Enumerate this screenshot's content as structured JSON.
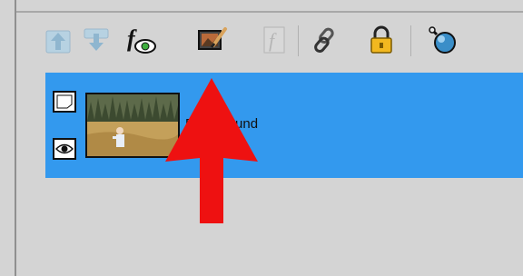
{
  "toolbar": {
    "items": [
      {
        "icon": "move-layer-up-icon",
        "enabled": false
      },
      {
        "icon": "move-layer-down-icon",
        "enabled": false
      },
      {
        "icon": "layer-effects-fx-icon",
        "enabled": true
      },
      {
        "icon": "photo-edit-brush-icon",
        "enabled": true
      },
      {
        "icon": "script-f-icon",
        "enabled": false
      },
      {
        "icon": "link-chain-icon",
        "enabled": true
      },
      {
        "icon": "lock-icon",
        "enabled": true
      },
      {
        "icon": "blend-ball-icon",
        "enabled": true
      }
    ]
  },
  "layer": {
    "name": "Background",
    "selected": true,
    "highlight_color": "#3399ee"
  },
  "annotation": {
    "arrow_color": "#ee1111",
    "target": "photo-edit-brush-icon"
  }
}
